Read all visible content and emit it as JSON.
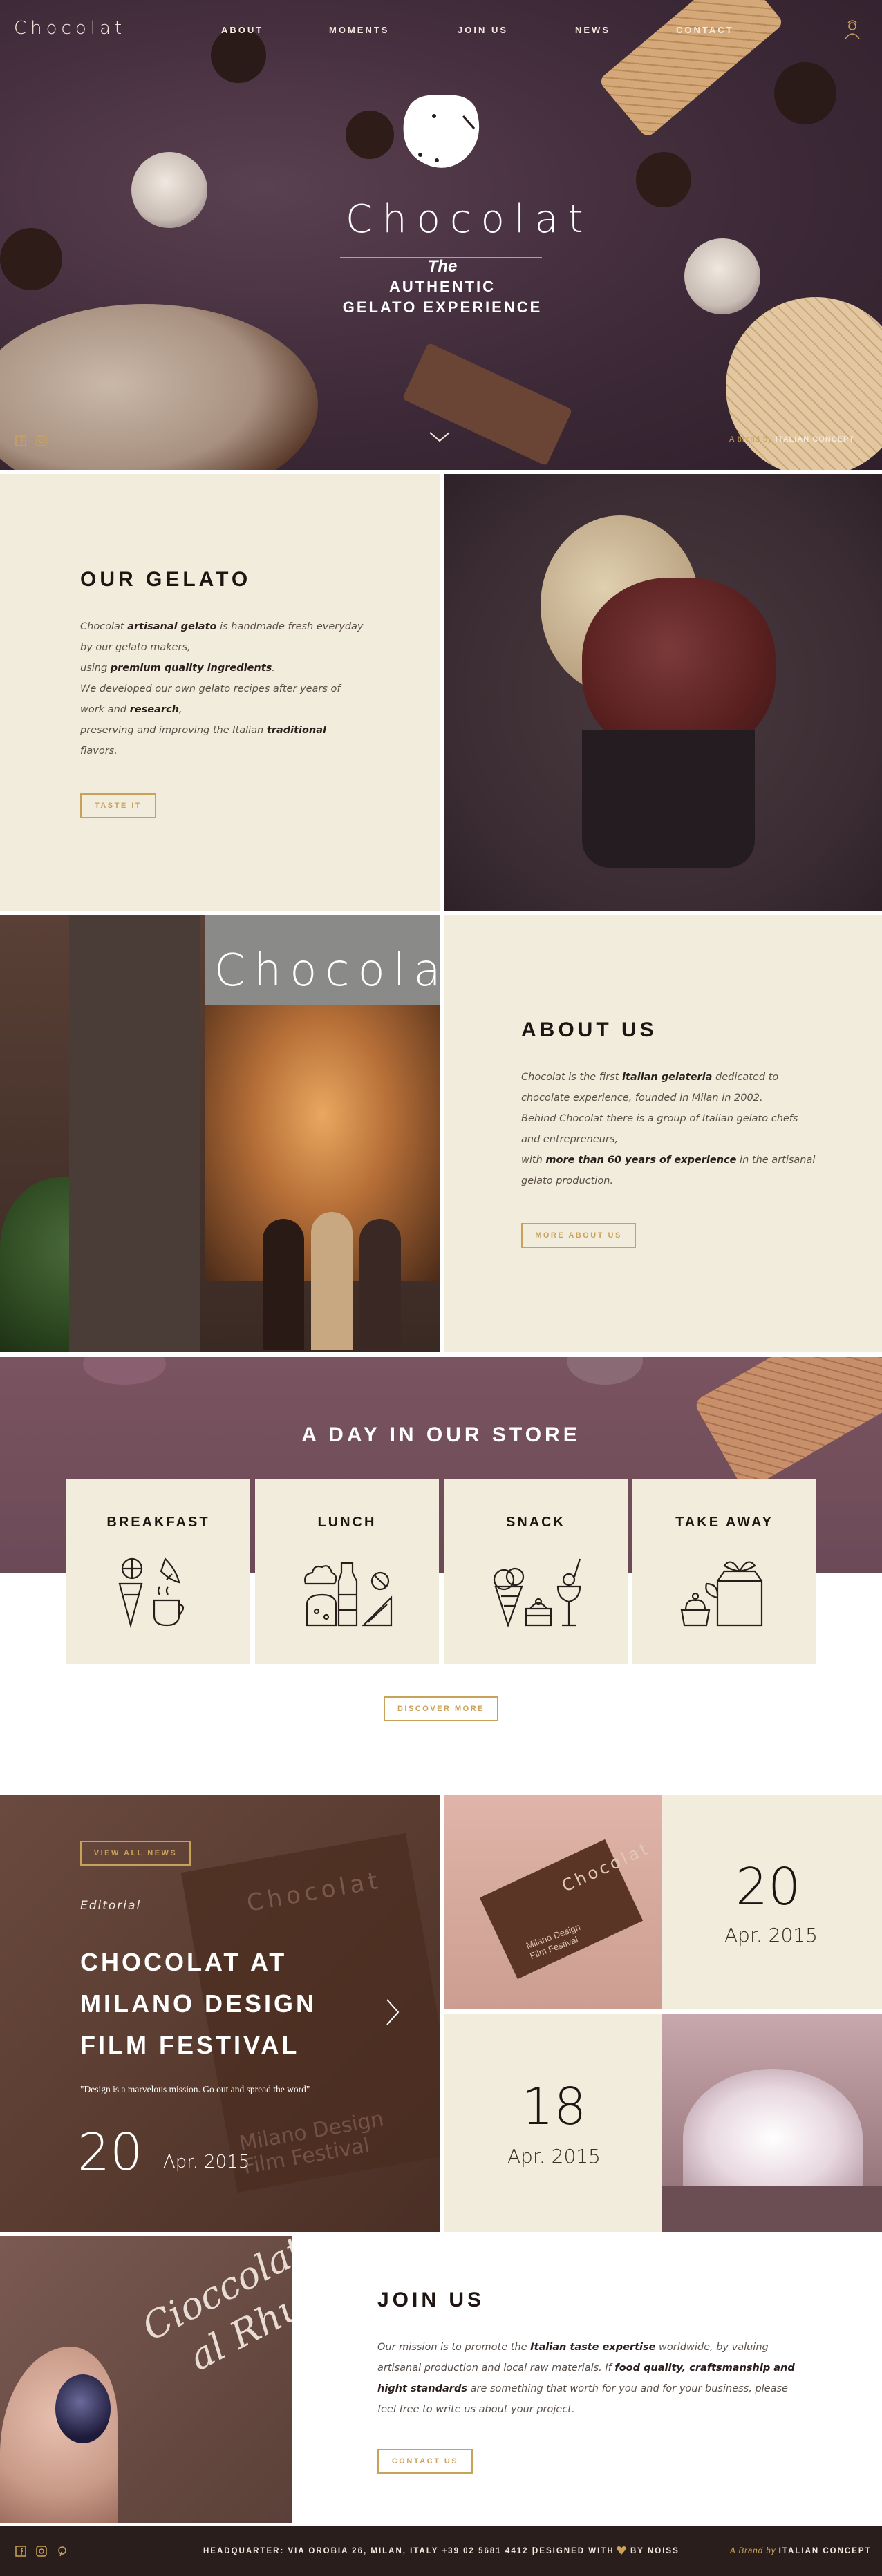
{
  "nav": {
    "logo": "Chocolat",
    "items": [
      "ABOUT",
      "MOMENTS",
      "JOIN US",
      "NEWS",
      "CONTACT"
    ]
  },
  "hero": {
    "logo": "Chocolat",
    "the": "The",
    "tag_line1": "AUTHENTIC",
    "tag_line2": "GELATO EXPERIENCE",
    "brand_prefix": "A brand by",
    "brand_name": "ITALIAN CONCEPT"
  },
  "gelato": {
    "title": "OUR GELATO",
    "p1_a": "Chocolat ",
    "p1_b": "artisanal gelato",
    "p1_c": " is handmade fresh everyday",
    "p2": "by our gelato makers,",
    "p3_a": "using ",
    "p3_b": "premium quality ingredients",
    "p3_c": ".",
    "p4": "We developed our own gelato recipes after years of",
    "p5_a": "work and ",
    "p5_b": "research",
    "p5_c": ",",
    "p6_a": "preserving and improving the Italian ",
    "p6_b": "traditional",
    "p7": "flavors.",
    "button": "TASTE IT"
  },
  "about": {
    "title": "ABOUT US",
    "p1_a": "Chocolat is the first ",
    "p1_b": "italian gelateria",
    "p1_c": " dedicated to",
    "p2": "chocolate experience, founded in Milan in 2002.",
    "p3": "Behind Chocolat there is a group of Italian gelato chefs",
    "p4": "and entrepreneurs,",
    "p5_a": "with ",
    "p5_b": "more than 60 years of experience",
    "p5_c": " in the artisanal",
    "p6": "gelato production.",
    "button": "MORE ABOUT US",
    "sign": "Chocola"
  },
  "store": {
    "title": "A DAY IN OUR STORE",
    "cards": [
      "BREAKFAST",
      "LUNCH",
      "SNACK",
      "TAKE AWAY"
    ],
    "button": "DISCOVER MORE"
  },
  "news": {
    "view_all": "VIEW ALL NEWS",
    "category": "Editorial",
    "title_l1": "CHOCOLAT AT",
    "title_l2": "MILANO DESIGN",
    "title_l3": "FILM FESTIVAL",
    "quote": "\"Design is a marvelous mission. Go out and spread the word\"",
    "day": "20",
    "month": "Apr. 2015",
    "tile1_day": "20",
    "tile1_month": "Apr. 2015",
    "tile2_day": "18",
    "tile2_month": "Apr. 2015",
    "box_text_1": "Chocolat",
    "box_text_2": "Milano Design",
    "box_text_3": "Film Festival"
  },
  "join": {
    "title": "JOIN US",
    "l1_a": "Our mission is to promote the ",
    "l1_b": "Italian taste expertise",
    "l1_c": " worldwide, by valuing",
    "l2_a": "artisanal production and local raw materials. If ",
    "l2_b": "food quality, craftsmanship and",
    "l3_a": "hight standards",
    "l3_b": " are something that worth for you and for your business, please",
    "l4": "feel free to write us about your project.",
    "button": "CONTACT US",
    "chalk_1": "Cioccolato",
    "chalk_2": "al Rhum"
  },
  "footer": {
    "address": "HEADQUARTER: VIA OROBIA 26, MILAN, ITALY +39 02 5681 4412 |",
    "designed": "DESIGNED WITH",
    "by": "BY NOISS",
    "brand_prefix": "A Brand by",
    "brand_name": "ITALIAN CONCEPT"
  },
  "colors": {
    "accent": "#c9a25a",
    "cream": "#f2ecdc",
    "dark": "#2a1e1c",
    "hero_bg": "#3e2a38"
  }
}
